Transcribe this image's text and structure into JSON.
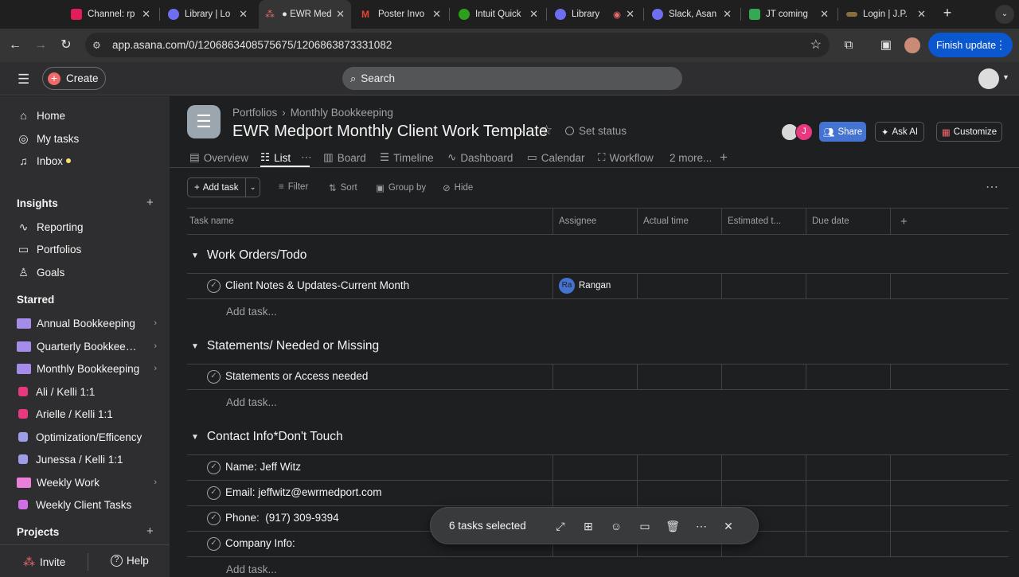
{
  "browser": {
    "tabs": [
      {
        "title": "Channel: rp",
        "color": "#e01e5a"
      },
      {
        "title": "Library | Lo",
        "color": "#6d6ef0"
      },
      {
        "title": "EWR Med",
        "color": "#f06a6a"
      },
      {
        "title": "Poster Invo",
        "color": "#ea4335"
      },
      {
        "title": "Intuit Quick",
        "color": "#2ca01c"
      },
      {
        "title": "Library",
        "color": "#6d6ef0"
      },
      {
        "title": "Slack, Asan",
        "color": "#6d6ef0"
      },
      {
        "title": "JT coming",
        "color": "#34a853"
      },
      {
        "title": "Login | J.P.",
        "color": "#8a6d3b"
      }
    ],
    "url": "app.asana.com/0/1206863408575675/1206863873331082",
    "finish_update": "Finish update"
  },
  "topbar": {
    "create_label": "Create",
    "search_label": "Search"
  },
  "sidebar": {
    "nav": [
      {
        "label": "Home",
        "icon": "home-icon"
      },
      {
        "label": "My tasks",
        "icon": "check-circle-icon"
      },
      {
        "label": "Inbox",
        "icon": "bell-icon"
      }
    ],
    "insights_heading": "Insights",
    "insights": [
      {
        "label": "Reporting",
        "icon": "chart-icon"
      },
      {
        "label": "Portfolios",
        "icon": "folder-icon"
      },
      {
        "label": "Goals",
        "icon": "person-icon"
      }
    ],
    "starred_heading": "Starred",
    "starred": [
      {
        "label": "Annual Bookkeeping",
        "type": "portfolio",
        "color": "#a58ce8"
      },
      {
        "label": "Quarterly Bookkeepi...",
        "type": "portfolio",
        "color": "#a58ce8"
      },
      {
        "label": "Monthly Bookkeeping",
        "type": "portfolio",
        "color": "#a58ce8"
      },
      {
        "label": "Ali / Kelli 1:1",
        "type": "project",
        "color": "#e8387f"
      },
      {
        "label": "Arielle / Kelli 1:1",
        "type": "project",
        "color": "#e8387f"
      },
      {
        "label": "Optimization/Efficency",
        "type": "project",
        "color": "#9e9ee8"
      },
      {
        "label": "Junessa / Kelli 1:1",
        "type": "project",
        "color": "#9e9ee8"
      },
      {
        "label": "Weekly Work",
        "type": "portfolio",
        "color": "#e87fd8"
      },
      {
        "label": "Weekly Client Tasks",
        "type": "project",
        "color": "#d16ee6"
      }
    ],
    "projects_heading": "Projects",
    "invite_label": "Invite",
    "help_label": "Help"
  },
  "header": {
    "breadcrumb": [
      "Portfolios",
      "Monthly Bookkeeping"
    ],
    "title": "EWR Medport Monthly Client Work Template",
    "set_status": "Set status",
    "share": "Share",
    "ask_ai": "Ask AI",
    "customize": "Customize",
    "avatar_initial": "J"
  },
  "views": {
    "tabs": [
      "Overview",
      "List",
      "Board",
      "Timeline",
      "Dashboard",
      "Calendar",
      "Workflow",
      "2 more..."
    ],
    "active": "List"
  },
  "actions": {
    "add_task": "Add task",
    "filter": "Filter",
    "sort": "Sort",
    "group_by": "Group by",
    "hide": "Hide"
  },
  "table": {
    "columns": [
      "Task name",
      "Assignee",
      "Actual time",
      "Estimated t...",
      "Due date"
    ],
    "add_task_label": "Add task...",
    "sections": [
      {
        "name": "Work Orders/Todo",
        "tasks": [
          {
            "name": "Client Notes & Updates-Current Month",
            "assignee": "Rangan",
            "assignee_initials": "Ra"
          }
        ]
      },
      {
        "name": "Statements/ Needed or Missing",
        "tasks": [
          {
            "name": "Statements or Access needed",
            "assignee": "",
            "assignee_initials": ""
          }
        ]
      },
      {
        "name": "Contact Info*Don't Touch",
        "tasks": [
          {
            "name": "Name: Jeff Witz",
            "assignee": "",
            "assignee_initials": ""
          },
          {
            "name": "Email: jeffwitz@ewrmedport.com",
            "assignee": "",
            "assignee_initials": ""
          },
          {
            "name": "Phone:  (917) 309-9394",
            "assignee": "",
            "assignee_initials": ""
          },
          {
            "name": "Company Info:",
            "assignee": "",
            "assignee_initials": ""
          }
        ]
      }
    ]
  },
  "selection_bar": {
    "count_label": "6 tasks selected"
  }
}
